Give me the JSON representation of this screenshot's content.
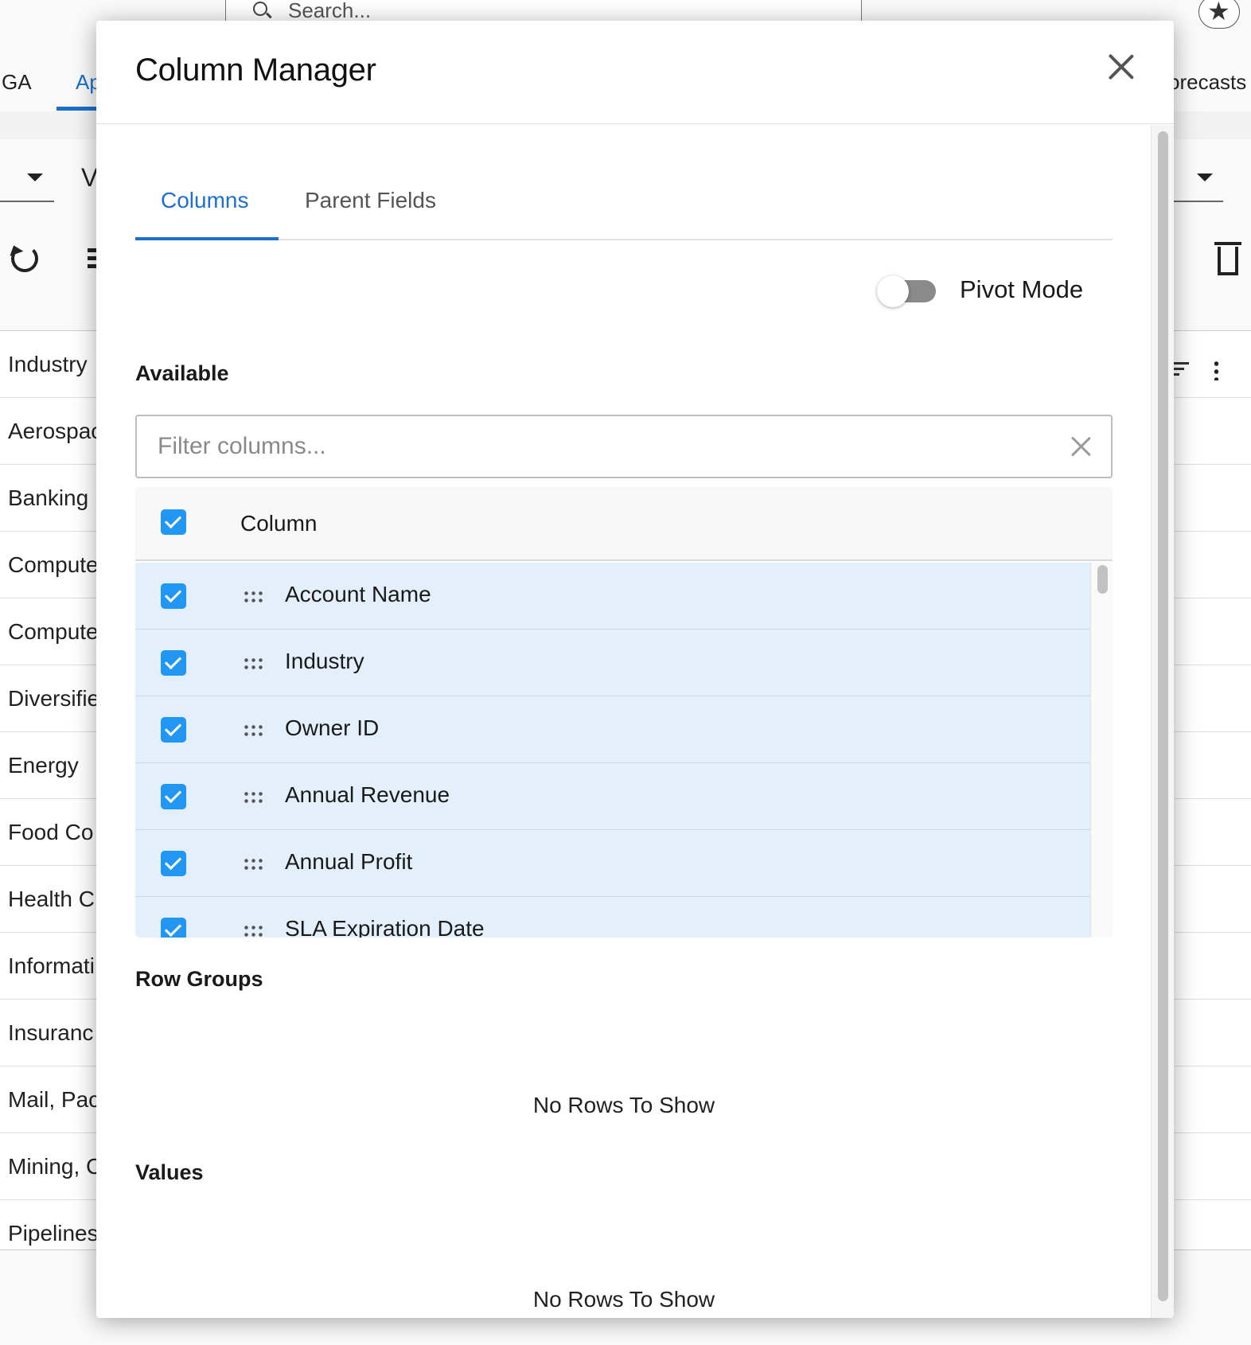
{
  "background": {
    "search_placeholder": "Search...",
    "nav_tabs": [
      "GA",
      "Ap",
      "orecasts"
    ],
    "view_prefix": "V",
    "grid_header": "Industry",
    "grid_rows": [
      "Aerospac",
      "Banking",
      "Compute",
      "Compute",
      "Diversifie",
      "Energy",
      "Food Co",
      "Health C",
      "Informati",
      "Insuranc",
      "Mail, Pac",
      "Mining, C",
      "Pipelines"
    ],
    "icons": [
      "search-icon",
      "star-icon",
      "chevron-down-icon",
      "refresh-icon",
      "menu-icon",
      "trash-icon",
      "filter-icon",
      "more-vert-icon"
    ]
  },
  "modal": {
    "title": "Column Manager",
    "close_icon": "close-icon",
    "tabs": [
      {
        "label": "Columns",
        "active": true
      },
      {
        "label": "Parent Fields",
        "active": false
      }
    ],
    "pivot_mode": {
      "label": "Pivot Mode",
      "enabled": false
    },
    "available": {
      "label": "Available",
      "filter_placeholder": "Filter columns...",
      "filter_value": "",
      "header_label": "Column",
      "header_checked": true,
      "columns": [
        {
          "label": "Account Name",
          "checked": true
        },
        {
          "label": "Industry",
          "checked": true
        },
        {
          "label": "Owner ID",
          "checked": true
        },
        {
          "label": "Annual Revenue",
          "checked": true
        },
        {
          "label": "Annual Profit",
          "checked": true
        },
        {
          "label": "SLA Expiration Date",
          "checked": true
        }
      ]
    },
    "row_groups": {
      "label": "Row Groups",
      "empty_text": "No Rows To Show"
    },
    "values": {
      "label": "Values",
      "empty_text": "No Rows To Show"
    }
  },
  "colors": {
    "accent": "#1e6fd0",
    "checkbox": "#2196f3",
    "row_selected": "#e3f0fb"
  }
}
